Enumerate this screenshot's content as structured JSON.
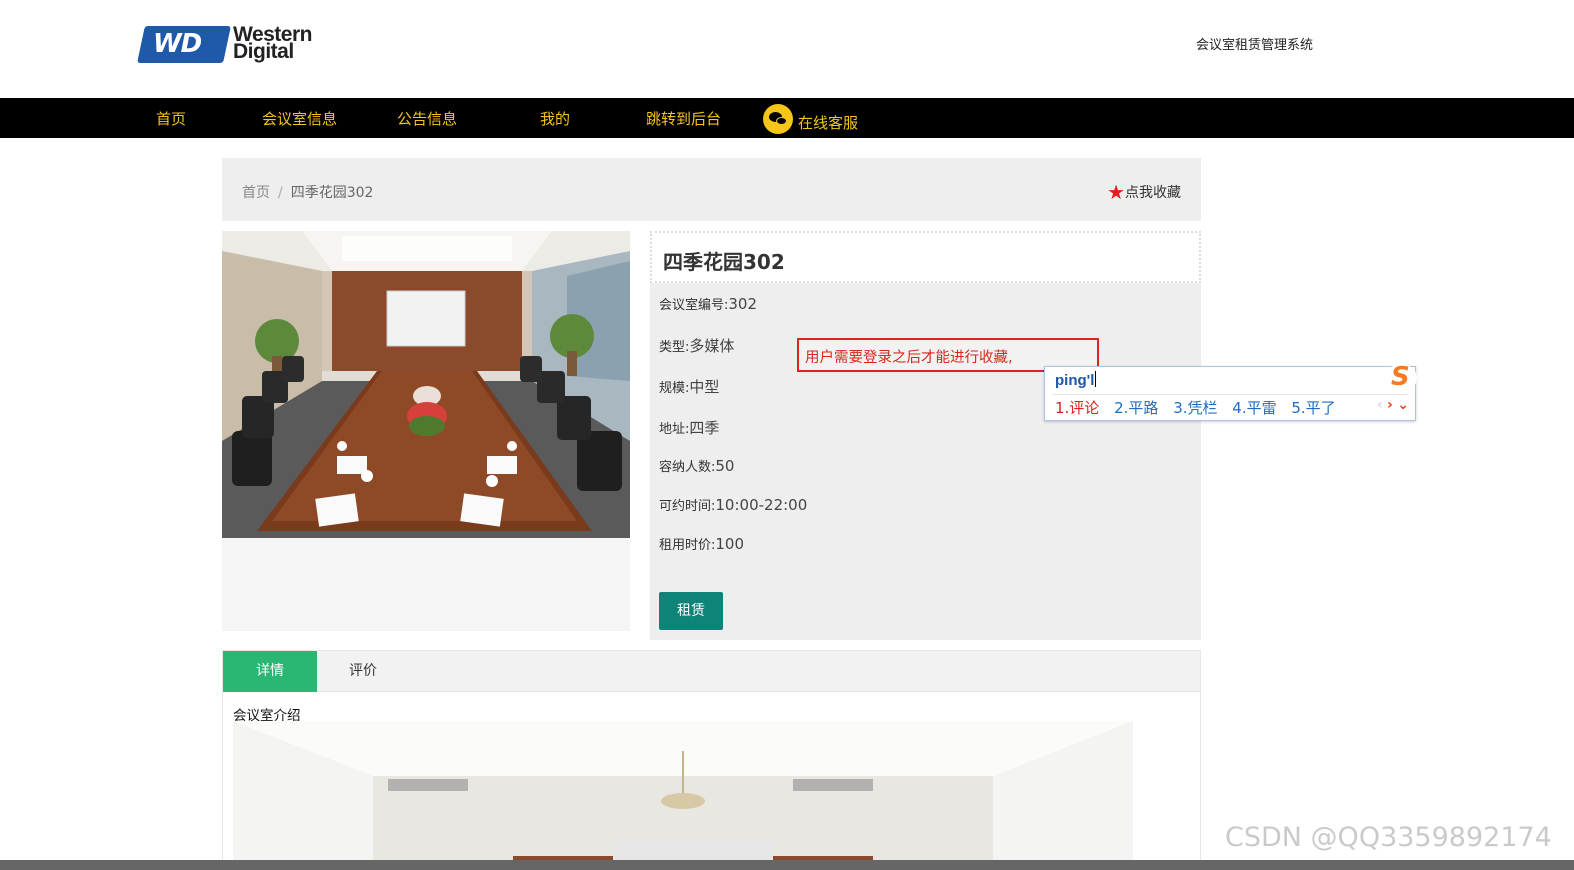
{
  "header": {
    "logo_line1": "Western",
    "logo_line2": "Digital",
    "logo_mark": "WD",
    "system_title": "会议室租赁管理系统"
  },
  "nav": {
    "items": [
      "首页",
      "会议室信息",
      "公告信息",
      "我的",
      "跳转到后台"
    ],
    "service": "在线客服",
    "color": "#f5c518"
  },
  "breadcrumb": {
    "home": "首页",
    "separator": "/",
    "current": "四季花园302"
  },
  "favorite": {
    "label": "点我收藏",
    "icon": "star-icon"
  },
  "room": {
    "title": "四季花园302",
    "fields": [
      {
        "key": "会议室编号:",
        "value": "302"
      },
      {
        "key": "类型:",
        "value": "多媒体"
      },
      {
        "key": "规模:",
        "value": "中型"
      },
      {
        "key": "地址:",
        "value": "四季"
      },
      {
        "key": "容纳人数:",
        "value": "50"
      },
      {
        "key": "可约时间:",
        "value": "10:00-22:00"
      },
      {
        "key": "租用时价:",
        "value": "100"
      }
    ],
    "rent_button": "租赁",
    "button_color": "#0e8377"
  },
  "toast": {
    "message": "用户需要登录之后才能进行收藏,"
  },
  "ime": {
    "input": "ping'l",
    "candidates": [
      "1.评论",
      "2.平路",
      "3.凭栏",
      "4.平雷",
      "5.平了"
    ]
  },
  "tabs": {
    "items": [
      "详情",
      "评价"
    ],
    "active_color": "#2bb673"
  },
  "detail": {
    "intro_label": "会议室介绍"
  },
  "watermark": "CSDN @QQ3359892174"
}
